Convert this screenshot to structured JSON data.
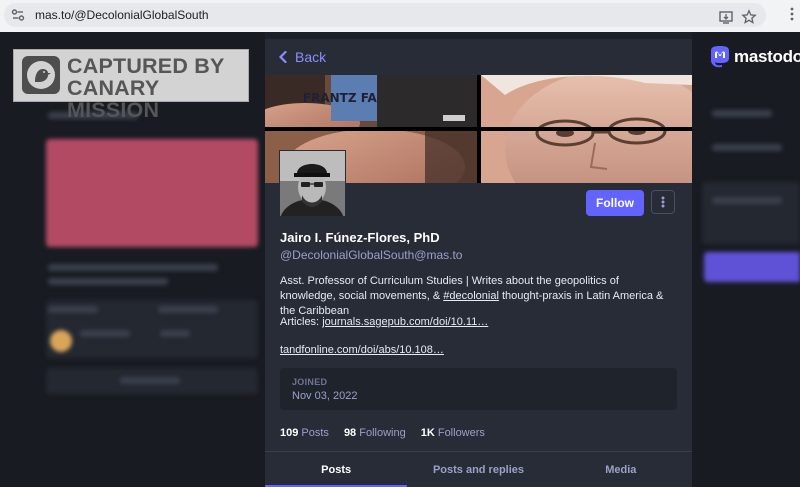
{
  "browser": {
    "url": "mas.to/@DecolonialGlobalSouth"
  },
  "watermark": {
    "line1": "CAPTURED BY",
    "line2": "CANARY MISSION"
  },
  "brand": {
    "name": "mastodon",
    "accent": "#6364ff"
  },
  "profile": {
    "back_label": "Back",
    "follow_label": "Follow",
    "display_name": "Jairo I. Fúnez-Flores, PhD",
    "handle": "@DecolonialGlobalSouth@mas.to",
    "bio_part1": "Asst. Professor of Curriculum Studies | Writes about the geopolitics of knowledge, social movements, & ",
    "bio_hashtag": "#decolonial",
    "bio_part2": " thought-praxis in Latin America & the Caribbean",
    "articles_label": "Articles: ",
    "article_link_1": "journals.sagepub.com/doi/10.11…",
    "article_link_2": "tandfonline.com/doi/abs/10.108…",
    "joined_label": "JOINED",
    "joined_date": "Nov 03, 2022",
    "stats": {
      "posts_count": "109",
      "posts_label": "Posts",
      "following_count": "98",
      "following_label": "Following",
      "followers_count": "1K",
      "followers_label": "Followers"
    },
    "header_poster_text": "FRANTZ FANON"
  },
  "tabs": [
    "Posts",
    "Posts and replies",
    "Media"
  ]
}
